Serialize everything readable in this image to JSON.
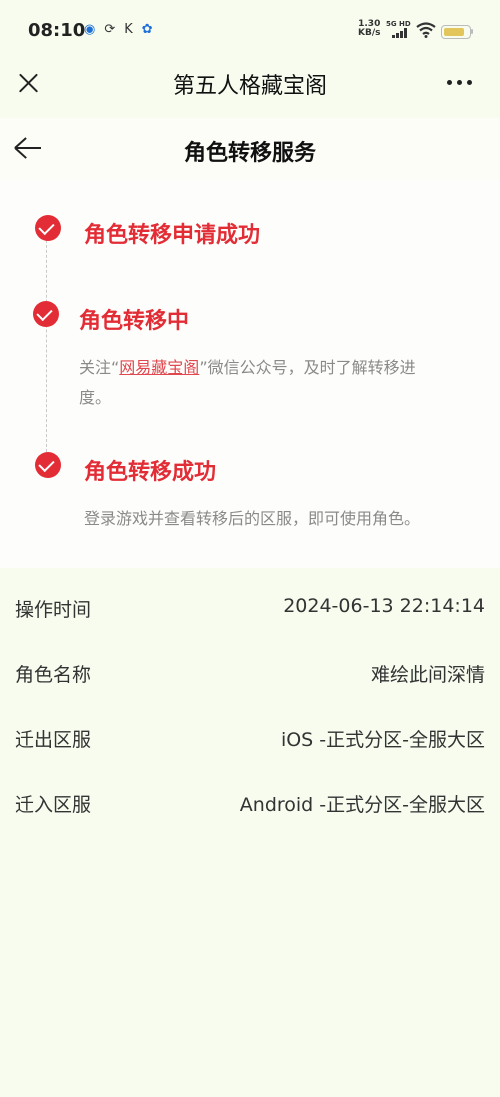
{
  "status_bar": {
    "time": "08:10",
    "net_speed_top": "1.30",
    "net_speed_bottom": "KB/s",
    "signal_label": "5G HD"
  },
  "header": {
    "title": "第五人格藏宝阁"
  },
  "subheader": {
    "title": "角色转移服务"
  },
  "steps": [
    {
      "title": "角色转移申请成功"
    },
    {
      "title": "角色转移中",
      "desc_prefix": "关注“",
      "link": "网易藏宝阁",
      "desc_suffix": "”微信公众号，及时了解转移进",
      "desc_wrap": "度。"
    },
    {
      "title": "角色转移成功",
      "desc": "登录游戏并查看转移后的区服，即可使用角色。"
    }
  ],
  "info": {
    "rows": [
      {
        "label": "操作时间",
        "value": "2024-06-13 22:14:14"
      },
      {
        "label": "角色名称",
        "value": "难绘此间深情"
      },
      {
        "label": "迁出区服",
        "value": "iOS -正式分区-全服大区"
      },
      {
        "label": "迁入区服",
        "value": "Android -正式分区-全服大区"
      }
    ]
  },
  "colors": {
    "accent": "#e32d36",
    "background": "#f7fcef"
  }
}
